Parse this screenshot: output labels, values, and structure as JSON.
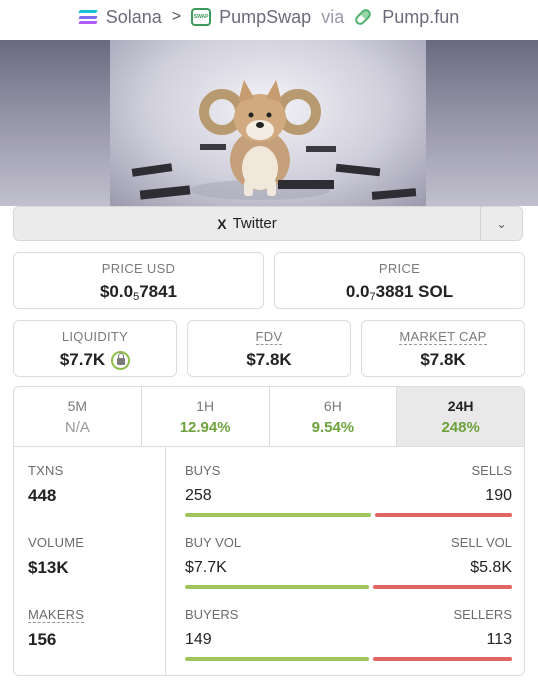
{
  "breadcrumb": {
    "chain": "Solana",
    "dex": "PumpSwap",
    "via": "via",
    "launchpad": "Pump.fun",
    "separator": ">"
  },
  "social": {
    "twitter_label": "Twitter",
    "twitter_icon": "X"
  },
  "price": {
    "usd_label": "PRICE USD",
    "usd_prefix": "$0.0",
    "usd_sub": "5",
    "usd_digits": "7841",
    "sol_label": "PRICE",
    "sol_prefix": "0.0",
    "sol_sub": "7",
    "sol_digits": "3881 SOL"
  },
  "metrics": {
    "liquidity_label": "LIQUIDITY",
    "liquidity_value": "$7.7K",
    "fdv_label": "FDV",
    "fdv_value": "$7.8K",
    "mcap_label": "MARKET CAP",
    "mcap_value": "$7.8K"
  },
  "timeframes": [
    {
      "label": "5M",
      "change": "N/A"
    },
    {
      "label": "1H",
      "change": "12.94%"
    },
    {
      "label": "6H",
      "change": "9.54%"
    },
    {
      "label": "24H",
      "change": "248%"
    }
  ],
  "stats": {
    "txns_label": "TXNS",
    "txns_value": "448",
    "volume_label": "VOLUME",
    "volume_value": "$13K",
    "makers_label": "MAKERS",
    "makers_value": "156",
    "buys_label": "BUYS",
    "buys_value": "258",
    "sells_label": "SELLS",
    "sells_value": "190",
    "buys_share": 0.576,
    "buyvol_label": "BUY VOL",
    "buyvol_value": "$7.7K",
    "sellvol_label": "SELL VOL",
    "sellvol_value": "$5.8K",
    "buyvol_share": 0.57,
    "buyers_label": "BUYERS",
    "buyers_value": "149",
    "sellers_label": "SELLERS",
    "sellers_value": "113",
    "buyers_share": 0.569
  },
  "colors": {
    "positive": "#6ea23c",
    "buy_bar": "#9dc55c",
    "sell_bar": "#e06666",
    "solana_gradient": [
      "#9945ff",
      "#19fb9b"
    ]
  }
}
